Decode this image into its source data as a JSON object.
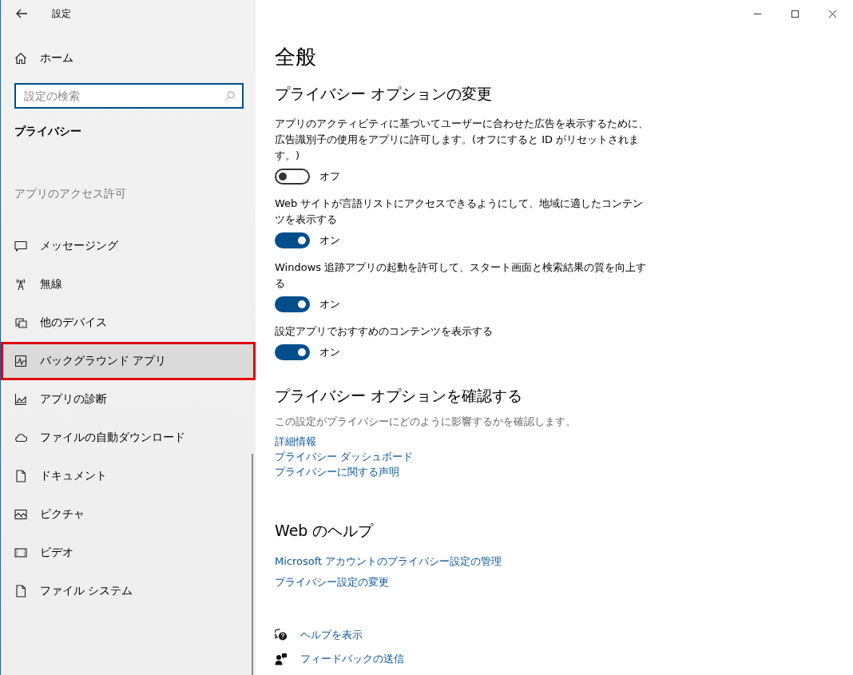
{
  "window": {
    "title": "設定"
  },
  "sidebar": {
    "home": "ホーム",
    "search": {
      "placeholder": "設定の検索"
    },
    "category": "プライバシー",
    "section": "アプリのアクセス許可",
    "items": [
      {
        "label": "メッセージング",
        "selected": false,
        "outlined": false
      },
      {
        "label": "無線",
        "selected": false,
        "outlined": false
      },
      {
        "label": "他のデバイス",
        "selected": false,
        "outlined": false
      },
      {
        "label": "バックグラウンド アプリ",
        "selected": true,
        "outlined": true
      },
      {
        "label": "アプリの診断",
        "selected": false,
        "outlined": false
      },
      {
        "label": "ファイルの自動ダウンロード",
        "selected": false,
        "outlined": false
      },
      {
        "label": "ドキュメント",
        "selected": false,
        "outlined": false
      },
      {
        "label": "ピクチャ",
        "selected": false,
        "outlined": false
      },
      {
        "label": "ビデオ",
        "selected": false,
        "outlined": false
      },
      {
        "label": "ファイル システム",
        "selected": false,
        "outlined": false
      }
    ]
  },
  "main": {
    "title": "全般",
    "options_heading": "プライバシー オプションの変更",
    "settings": [
      {
        "description": "アプリのアクティビティに基づいてユーザーに合わせた広告を表示するために、広告識別子の使用をアプリに許可します。(オフにすると ID がリセットされます。)",
        "on": false,
        "state_label": "オフ"
      },
      {
        "description": "Web サイトが言語リストにアクセスできるようにして、地域に適したコンテンツを表示する",
        "on": true,
        "state_label": "オン"
      },
      {
        "description": "Windows 追跡アプリの起動を許可して、スタート画面と検索結果の質を向上する",
        "on": true,
        "state_label": "オン"
      },
      {
        "description": "設定アプリでおすすめのコンテンツを表示する",
        "on": true,
        "state_label": "オン"
      }
    ],
    "review_heading": "プライバシー オプションを確認する",
    "review_text": "この設定がプライバシーにどのように影響するかを確認します。",
    "review_links": [
      "詳細情報",
      "プライバシー ダッシュボード",
      "プライバシーに関する声明"
    ],
    "web_help_heading": "Web のヘルプ",
    "web_help_links": [
      "Microsoft アカウントのプライバシー設定の管理",
      "プライバシー設定の変更"
    ],
    "footer_links": [
      "ヘルプを表示",
      "フィードバックの送信"
    ]
  }
}
